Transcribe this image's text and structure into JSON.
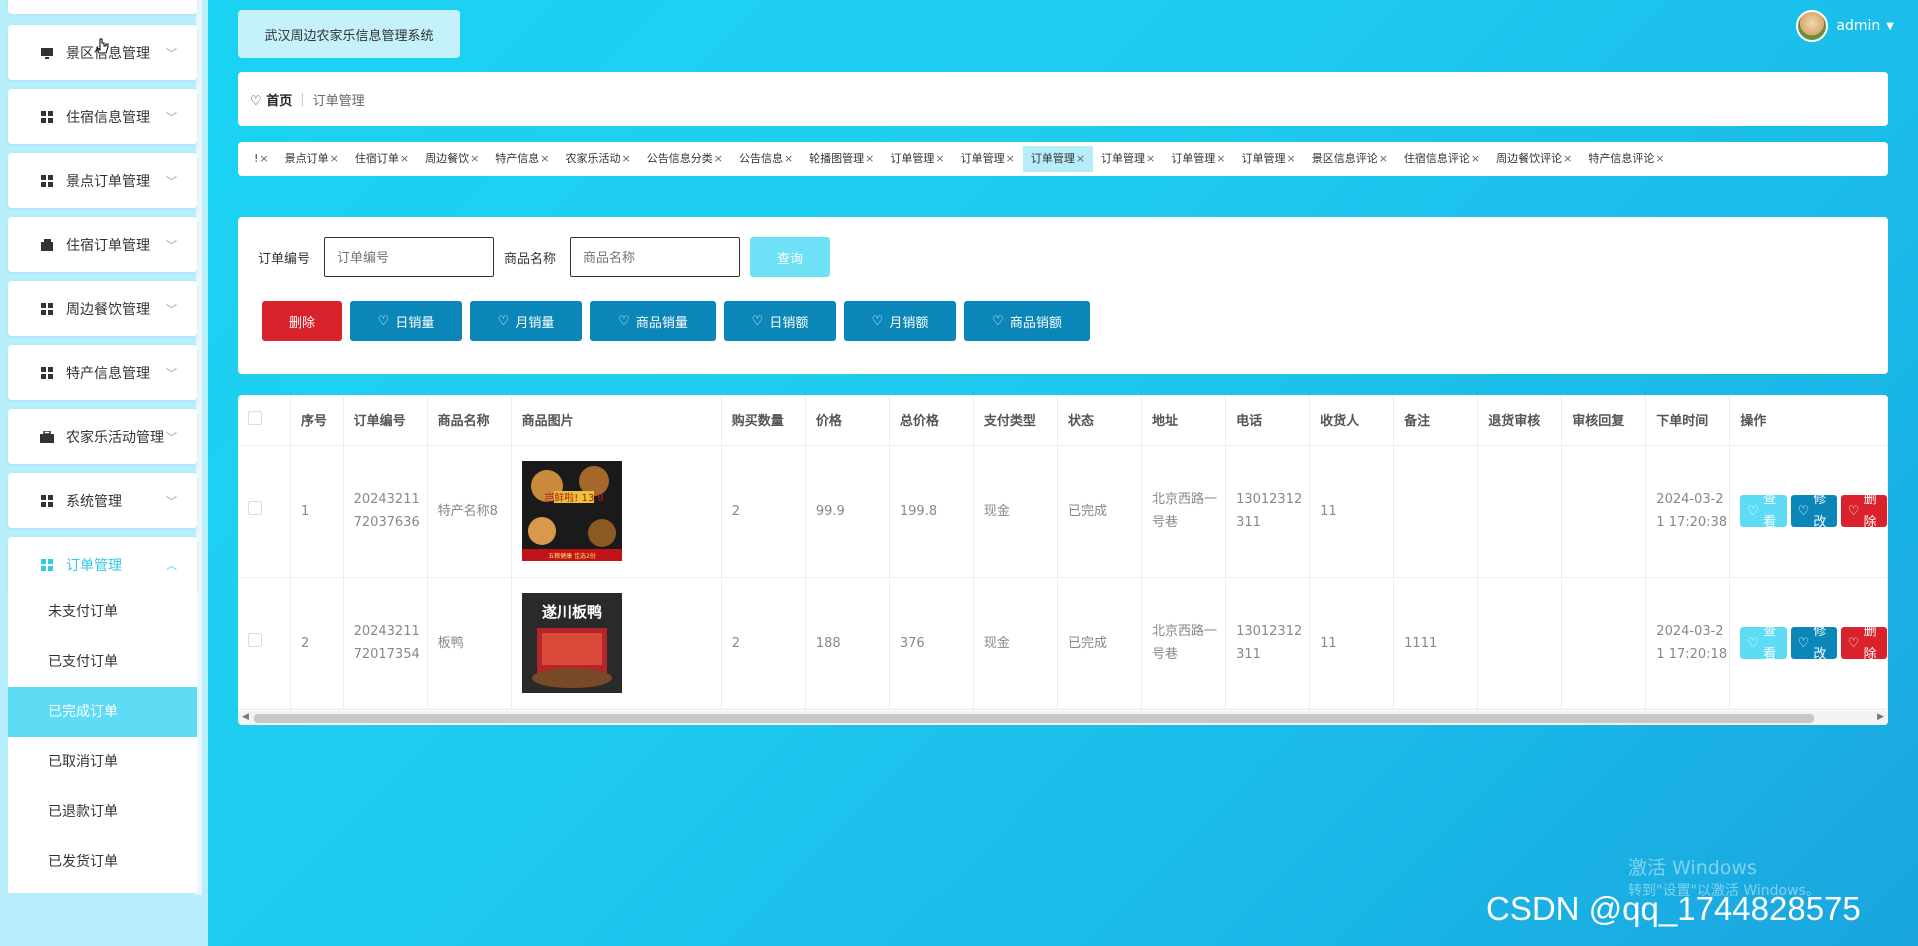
{
  "sidebar": {
    "items": [
      {
        "label": "景区信息管理",
        "icon": "monitor-icon"
      },
      {
        "label": "住宿信息管理",
        "icon": "grid-icon"
      },
      {
        "label": "景点订单管理",
        "icon": "grid-icon"
      },
      {
        "label": "住宿订单管理",
        "icon": "wallet-icon"
      },
      {
        "label": "周边餐饮管理",
        "icon": "grid-icon"
      },
      {
        "label": "特产信息管理",
        "icon": "grid-icon"
      },
      {
        "label": "农家乐活动管理",
        "icon": "briefcase-icon"
      },
      {
        "label": "系统管理",
        "icon": "grid-icon"
      },
      {
        "label": "订单管理",
        "icon": "grid-icon",
        "active": true
      }
    ],
    "submenu": [
      "未支付订单",
      "已支付订单",
      "已完成订单",
      "已取消订单",
      "已退款订单",
      "已发货订单"
    ],
    "active_sub": "已完成订单"
  },
  "header": {
    "system_title": "武汉周边农家乐信息管理系统",
    "user": "admin"
  },
  "breadcrumb": {
    "home": "首页",
    "current": "订单管理"
  },
  "tags": [
    "!",
    "景点订单",
    "住宿订单",
    "周边餐饮",
    "特产信息",
    "农家乐活动",
    "公告信息分类",
    "公告信息",
    "轮播图管理",
    "订单管理",
    "订单管理",
    "订单管理",
    "订单管理",
    "订单管理",
    "订单管理",
    "景区信息评论",
    "住宿信息评论",
    "周边餐饮评论",
    "特产信息评论"
  ],
  "active_tag_index": 11,
  "search": {
    "order_no_label": "订单编号",
    "order_no_placeholder": "订单编号",
    "product_name_label": "商品名称",
    "product_name_placeholder": "商品名称",
    "query_button": "查询"
  },
  "actions": {
    "delete": "删除",
    "daily_sales": "日销量",
    "monthly_sales": "月销量",
    "product_sales": "商品销量",
    "daily_revenue": "日销额",
    "monthly_revenue": "月销额",
    "product_revenue": "商品销额"
  },
  "table": {
    "headers": [
      "序号",
      "订单编号",
      "商品名称",
      "商品图片",
      "购买数量",
      "价格",
      "总价格",
      "支付类型",
      "状态",
      "地址",
      "电话",
      "收货人",
      "备注",
      "退货审核",
      "审核回复",
      "下单时间",
      "操作"
    ],
    "rows": [
      {
        "index": "1",
        "order_no": "2024321172037636",
        "product": "特产名称8",
        "image_caption": "岂鲜啦! 13.8",
        "image_footer": "五粮健康 佳选2份",
        "qty": "2",
        "price": "99.9",
        "total": "199.8",
        "pay_type": "现金",
        "status": "已完成",
        "address": "北京西路一号巷",
        "phone": "13012312311",
        "receiver": "11",
        "note": "",
        "return_review": "",
        "review_reply": "",
        "time": "2024-03-21 17:20:38"
      },
      {
        "index": "2",
        "order_no": "2024321172017354",
        "product": "板鸭",
        "image_caption": "遂川板鸭",
        "image_footer": "",
        "qty": "2",
        "price": "188",
        "total": "376",
        "pay_type": "现金",
        "status": "已完成",
        "address": "北京西路一号巷",
        "phone": "13012312311",
        "receiver": "11",
        "note": "1111",
        "return_review": "",
        "review_reply": "",
        "time": "2024-03-21 17:20:18"
      }
    ],
    "op_view": "查看",
    "op_edit": "修改",
    "op_delete": "删除"
  },
  "watermark": {
    "line1": "激活 Windows",
    "line2": "转到\"设置\"以激活 Windows。",
    "csdn": "CSDN @qq_1744828575"
  },
  "colors": {
    "accent": "#33c8e8",
    "primary": "#0a87b8",
    "danger": "#d9222c",
    "light": "#5fdcf5"
  }
}
